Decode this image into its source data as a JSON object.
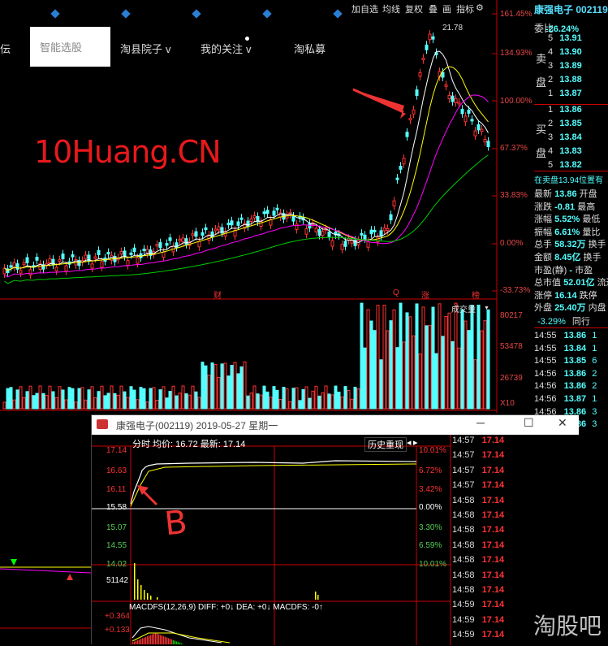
{
  "toolbar": {
    "items": [
      "加自选",
      "均线",
      "复权",
      "叠",
      "画",
      "指标"
    ]
  },
  "nav": {
    "cut_label": "伝",
    "active_label": "智能选股",
    "items": [
      {
        "label": "淘县院子",
        "chev": "v"
      },
      {
        "label": "我的关注",
        "chev": "v"
      },
      {
        "label": "淘私募",
        "chev": ""
      }
    ]
  },
  "watermark": "10Huang.CN",
  "price_axis": {
    "ticks": [
      "161.45%",
      "134.93%",
      "100.00%",
      "67.37%",
      "33.83%",
      "0.00%",
      "-33.73%"
    ],
    "peak_label": "21.78"
  },
  "event_marks": [
    "财",
    "Q",
    "涨",
    "榜"
  ],
  "volume": {
    "label": "成交量",
    "ticks": [
      "80217",
      "53478",
      "26739",
      "X10"
    ]
  },
  "stock": {
    "name": "康强电子",
    "code": "002119"
  },
  "order_book": {
    "wei_bi_label": "委比",
    "wei_bi": "-26.24%",
    "sell_label": [
      "卖",
      "盘"
    ],
    "buy_label": [
      "买",
      "盘"
    ],
    "sells": [
      {
        "n": "5",
        "p": "13.91"
      },
      {
        "n": "4",
        "p": "13.90"
      },
      {
        "n": "3",
        "p": "13.89"
      },
      {
        "n": "2",
        "p": "13.88"
      },
      {
        "n": "1",
        "p": "13.87"
      }
    ],
    "buys": [
      {
        "n": "1",
        "p": "13.86"
      },
      {
        "n": "2",
        "p": "13.85"
      },
      {
        "n": "3",
        "p": "13.84"
      },
      {
        "n": "4",
        "p": "13.83"
      },
      {
        "n": "5",
        "p": "13.82"
      }
    ],
    "notice": "在卖盘13.94位置有"
  },
  "quote": [
    {
      "k": "最新",
      "v": "13.86",
      "k2": "开盘"
    },
    {
      "k": "涨跌",
      "v": "-0.81",
      "k2": "最高"
    },
    {
      "k": "涨幅",
      "v": "5.52%",
      "k2": "最低"
    },
    {
      "k": "振幅",
      "v": "6.61%",
      "k2": "量比"
    },
    {
      "k": "总手",
      "v": "58.32万",
      "k2": "换手"
    },
    {
      "k": "金额",
      "v": "8.45亿",
      "k2": "换手"
    },
    {
      "k": "市盈(静)",
      "v": "-",
      "k2": "市盈"
    },
    {
      "k": "总市值",
      "v": "52.01亿",
      "k2": "流通"
    },
    {
      "k": "涨停",
      "v": "16.14",
      "k2": "跌停"
    },
    {
      "k": "外盘",
      "v": "25.40万",
      "k2": "内盘"
    }
  ],
  "side_flow": {
    "label": "-3.29%",
    "next": "同行"
  },
  "side_ticks": [
    {
      "t": "14:55",
      "p": "13.86",
      "v": "1"
    },
    {
      "t": "14:55",
      "p": "13.84",
      "v": "1"
    },
    {
      "t": "14:55",
      "p": "13.85",
      "v": "6"
    },
    {
      "t": "14:56",
      "p": "13.86",
      "v": "2"
    },
    {
      "t": "14:56",
      "p": "13.86",
      "v": "2"
    },
    {
      "t": "14:56",
      "p": "13.87",
      "v": "1"
    },
    {
      "t": "14:56",
      "p": "13.86",
      "v": "3"
    },
    {
      "t": "14:56",
      "p": "13.86",
      "v": "3"
    }
  ],
  "popup": {
    "title": "康强电子(002119) 2019-05-27 星期一",
    "header": "分时  均价: 16.72  最新: 17.14",
    "replay_btn": "历史重现",
    "left_prices": [
      "17.14",
      "16.63",
      "16.11",
      "15.58",
      "15.07",
      "14.55",
      "14.02"
    ],
    "right_pcts": [
      "10.01%",
      "6.72%",
      "3.42%",
      "0.00%",
      "3.30%",
      "6.59%",
      "10.01%"
    ],
    "volume_label": "51142",
    "macd": "MACDFS(12,26,9) DIFF: +0↓ DEA: +0↓ MACDFS: -0↑",
    "macd_ticks": [
      "+0.364",
      "+0.133"
    ],
    "annotation": "B",
    "ticks": [
      {
        "t": "14:57",
        "p": "17.14"
      },
      {
        "t": "14:57",
        "p": "17.14"
      },
      {
        "t": "14:57",
        "p": "17.14"
      },
      {
        "t": "14:57",
        "p": "17.14"
      },
      {
        "t": "14:58",
        "p": "17.14"
      },
      {
        "t": "14:58",
        "p": "17.14"
      },
      {
        "t": "14:58",
        "p": "17.14"
      },
      {
        "t": "14:58",
        "p": "17.14"
      },
      {
        "t": "14:58",
        "p": "17.14"
      },
      {
        "t": "14:58",
        "p": "17.14"
      },
      {
        "t": "14:58",
        "p": "17.14"
      },
      {
        "t": "14:59",
        "p": "17.14"
      },
      {
        "t": "14:59",
        "p": "17.14"
      },
      {
        "t": "14:59",
        "p": "17.14"
      }
    ]
  },
  "bottom_watermark": "淘股吧",
  "colors": {
    "up": "#ff3232",
    "down": "#54ffff",
    "accent": "#e8191c",
    "cyan": "#00c8c8"
  }
}
